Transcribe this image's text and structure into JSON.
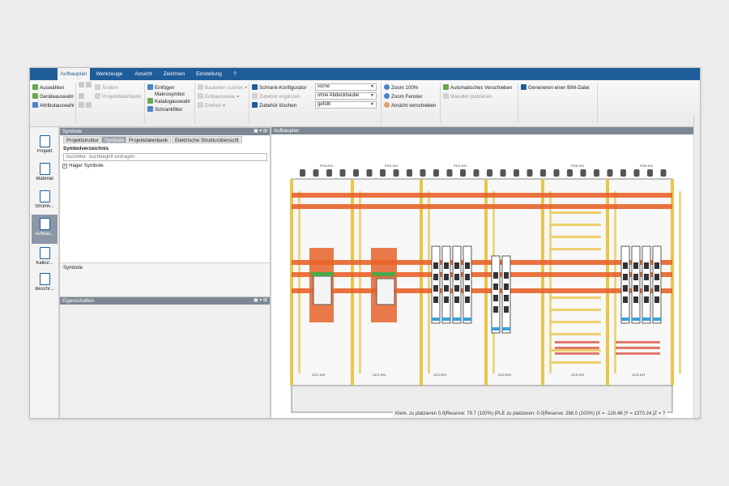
{
  "menu": {
    "tabs": [
      "Aufbauplan",
      "Werkzeuge",
      "Ansicht",
      "Zeichnen",
      "Einstellung",
      "?"
    ]
  },
  "ribbon": {
    "group1": [
      "Auswählen",
      "Geräteauswahl",
      "Attributauswahl"
    ],
    "group2": [
      "Ändern",
      "Projektdatenbank"
    ],
    "group3": [
      "Einfügen",
      "Makrosymbol",
      "Katalogauswahl",
      "Schrankfilter"
    ],
    "group4": [
      "Bauteilen suchen",
      "Einbauniveau",
      "Drehen"
    ],
    "group5": [
      "Schrank-Konfigurator",
      "Zubehör ergänzen",
      "Zubehör löschen"
    ],
    "selects": [
      "vorne",
      "ohne Abdeckhaube",
      "gefüllt"
    ],
    "group6": [
      "Zoom 100%",
      "Zoom Fenster",
      "Ansicht verschieben"
    ],
    "group7": [
      "Automatisches Verschieben",
      "Wandler platzieren"
    ],
    "group8": [
      "Generieren einer BIM-Datei"
    ]
  },
  "sidebar": {
    "items": [
      "Projekt",
      "Material",
      "Stromlaufplan",
      "Aufbauplan",
      "Kalkulation",
      "Beschriftung"
    ],
    "labels_shown": [
      "Projekt",
      "Material",
      "Stromli...",
      "Aufbau...",
      "Kalkul...",
      "Beschr..."
    ]
  },
  "symbole_panel": {
    "title": "Symbole",
    "tabs": [
      "Projektstruktur",
      "Symbole",
      "Projektdatenbank",
      "Elektrische Strukturübersicht"
    ],
    "verzeichnis_label": "Symbolverzeichnis",
    "search_placeholder": "Suchfilter: Suchbegriff eintragen",
    "tree_item": "Hager Symbole",
    "footer_label": "Symbole"
  },
  "eigenschaften_panel": {
    "title": "Eigenschaften"
  },
  "drawing": {
    "title": "Aufbauplan",
    "column_labels_top": [
      "PG3.2H1",
      "PG3.1H1",
      "PG4.1H1",
      "PG5.1H1",
      "PG6.1H1"
    ],
    "column_labels_bottom": [
      "UC2.1H4",
      "UC3.1H4",
      "UC2.5H1",
      "UC2.5H1",
      "UC3.1H1",
      "UC3.1H1"
    ]
  },
  "statusbar": {
    "text": "Klem. zu platzieren 0.0|Reserve: 79.7 (100%) |PLE zu platzieren: 0.0|Reserve: 288.0 (100%) |X = -126.46 |Y = 1370.24 |Z = ?"
  },
  "colors": {
    "brand": "#1f5d9a",
    "busbar_orange": "#e8632a",
    "rail_yellow": "#e8c64a",
    "frame_grey": "#9a9a9a"
  }
}
